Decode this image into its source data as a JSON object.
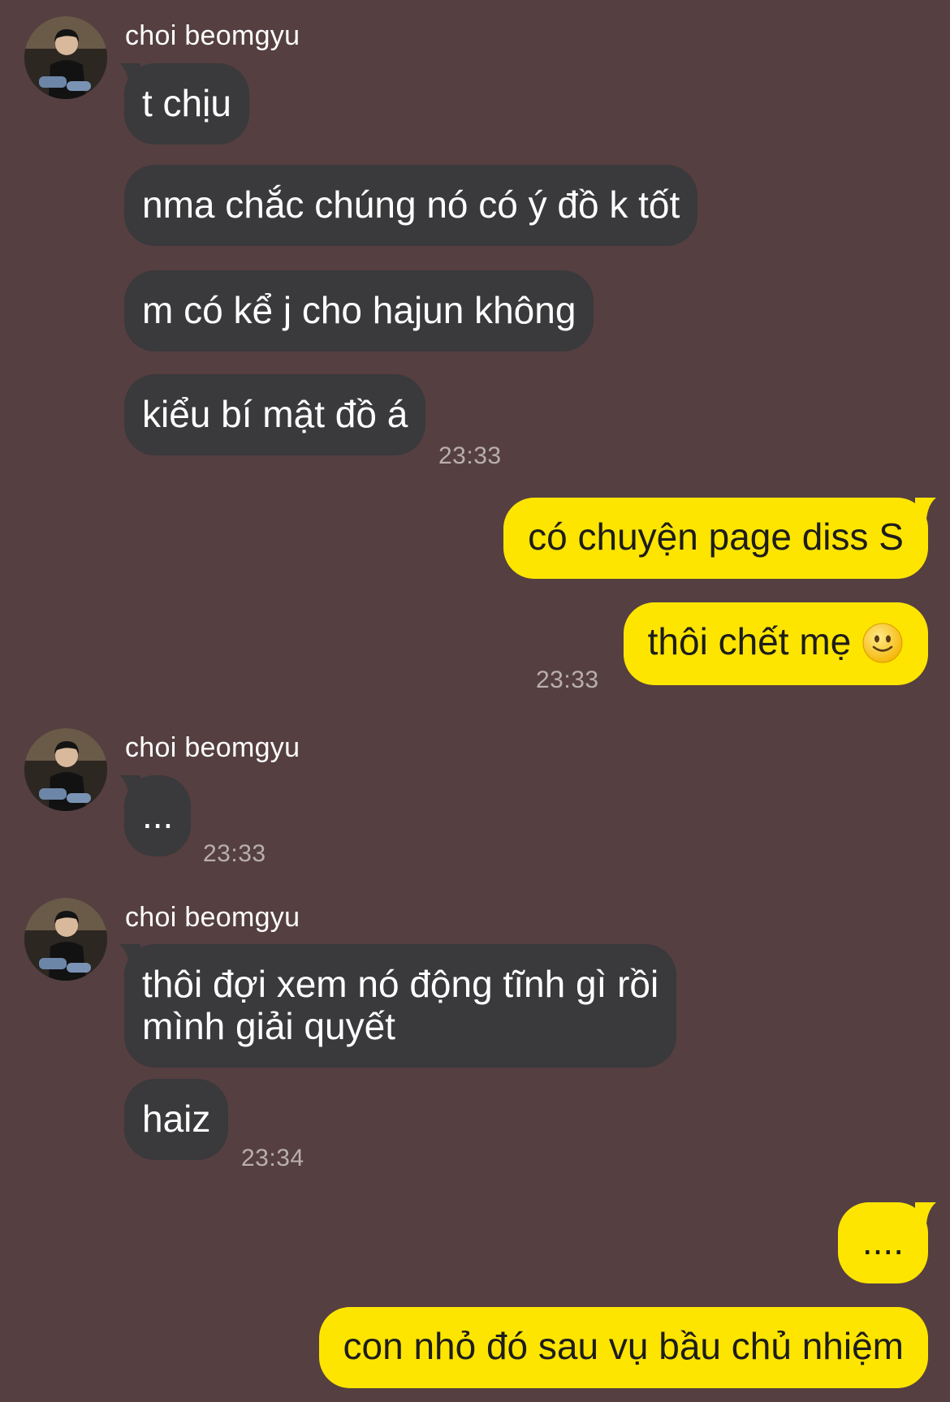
{
  "sender_name": "choi beomgyu",
  "groups": [
    {
      "messages": [
        {
          "text": "t chịu"
        },
        {
          "text": "nma chắc chúng nó có ý đồ k tốt"
        },
        {
          "text": "m có kể j cho hajun không"
        },
        {
          "text": "kiểu bí mật đồ á"
        }
      ],
      "time": "23:33"
    },
    {
      "messages": [
        {
          "text": "có chuyện page diss S"
        },
        {
          "text": "thôi chết mẹ"
        }
      ],
      "time": "23:33",
      "emoji": "slightly-smiling-face-icon"
    },
    {
      "messages": [
        {
          "text": "..."
        }
      ],
      "time": "23:33"
    },
    {
      "messages": [
        {
          "text": "thôi đợi xem nó động tĩnh gì rồi",
          "text2": "mình giải quyết"
        },
        {
          "text": "haiz"
        }
      ],
      "time": "23:34"
    },
    {
      "messages": [
        {
          "text": "...."
        },
        {
          "text": "con nhỏ đó sau vụ bầu chủ nhiệm"
        }
      ]
    }
  ],
  "colors": {
    "background": "#553f41",
    "incoming_bubble": "#3a393b",
    "outgoing_bubble": "#fee500",
    "timestamp": "#b9aeaf"
  }
}
